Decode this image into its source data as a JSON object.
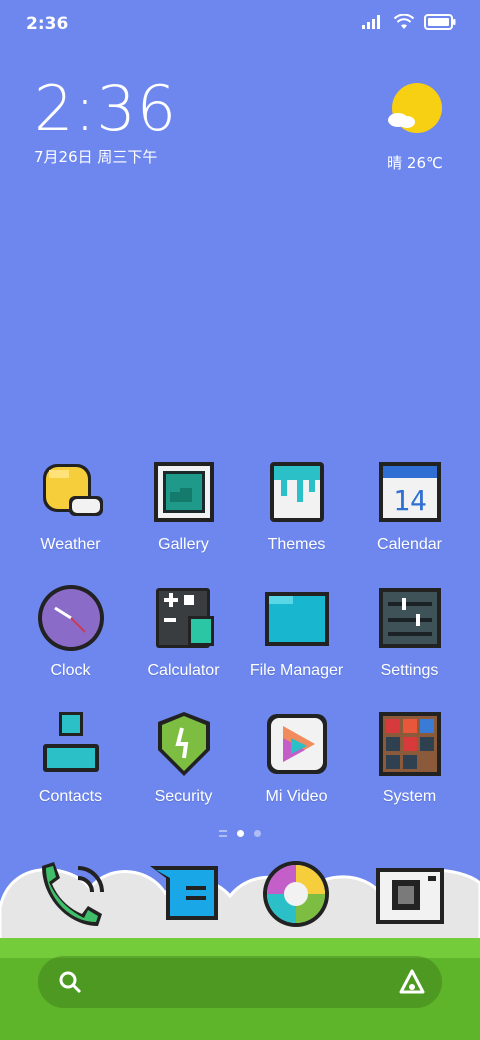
{
  "status_bar": {
    "time": "2:36",
    "icons": [
      "signal-icon",
      "wifi-icon",
      "battery-icon"
    ]
  },
  "clock_widget": {
    "time": "2:36",
    "date": "7月26日 周三下午"
  },
  "weather_widget": {
    "condition": "晴",
    "temperature": "26℃",
    "icon": "sun-cloud-icon"
  },
  "apps": [
    {
      "label": "Weather",
      "icon": "weather-icon"
    },
    {
      "label": "Gallery",
      "icon": "gallery-icon"
    },
    {
      "label": "Themes",
      "icon": "themes-icon"
    },
    {
      "label": "Calendar",
      "icon": "calendar-icon",
      "day": "14"
    },
    {
      "label": "Clock",
      "icon": "clock-icon"
    },
    {
      "label": "Calculator",
      "icon": "calculator-icon"
    },
    {
      "label": "File Manager",
      "icon": "folder-icon"
    },
    {
      "label": "Settings",
      "icon": "settings-icon"
    },
    {
      "label": "Contacts",
      "icon": "contacts-icon"
    },
    {
      "label": "Security",
      "icon": "security-icon"
    },
    {
      "label": "Mi Video",
      "icon": "video-icon"
    },
    {
      "label": "System",
      "icon": "system-folder-icon"
    }
  ],
  "dock": [
    {
      "icon": "phone-icon"
    },
    {
      "icon": "messages-icon"
    },
    {
      "icon": "browser-icon"
    },
    {
      "icon": "camera-icon"
    }
  ],
  "colors": {
    "wallpaper": "#6d87ef",
    "grass": "#5fb52a",
    "cloud": "#e6e6e6"
  }
}
